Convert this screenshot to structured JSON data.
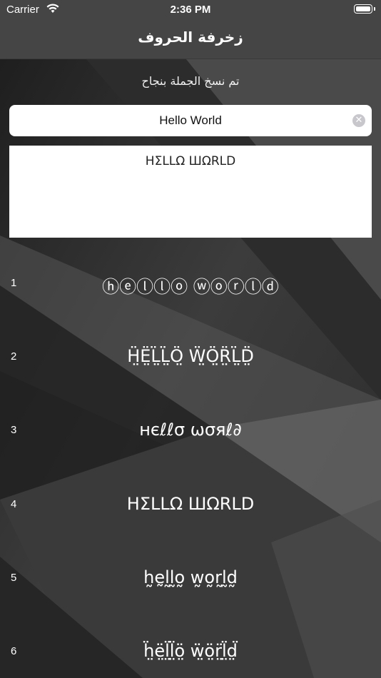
{
  "status_bar": {
    "carrier": "Carrier",
    "time": "2:36 PM"
  },
  "nav": {
    "title": "زخرفة الحروف"
  },
  "status_message": "تم نسخ الجملة بنجاح",
  "search": {
    "value": "Hello World",
    "clear_icon": "clear-circle-icon"
  },
  "output": {
    "text": "ΗΣLLΩ ШΩRLD"
  },
  "styles": [
    {
      "number": "1",
      "text": "ⓗⓔⓛⓛⓞ ⓦⓞⓡⓛⓓ"
    },
    {
      "number": "2",
      "text": "Ḧ̤Ë̤L̤̈L̤̈Ö̤ Ẅ̤Ö̤R̤̈L̤̈D̤̈"
    },
    {
      "number": "3",
      "text": "нєℓℓσ ωσяℓ∂"
    },
    {
      "number": "4",
      "text": "ΗΣLLΩ ШΩRLD"
    },
    {
      "number": "5",
      "text": "h̰ḛl̰l̰o̰ w̰o̰r̰l̰d̰"
    },
    {
      "number": "6",
      "text": "ḧ̤ë̤l̤̈l̤̈ö̤ ẅ̤ö̤r̤̈l̤̈d̤̈"
    }
  ]
}
